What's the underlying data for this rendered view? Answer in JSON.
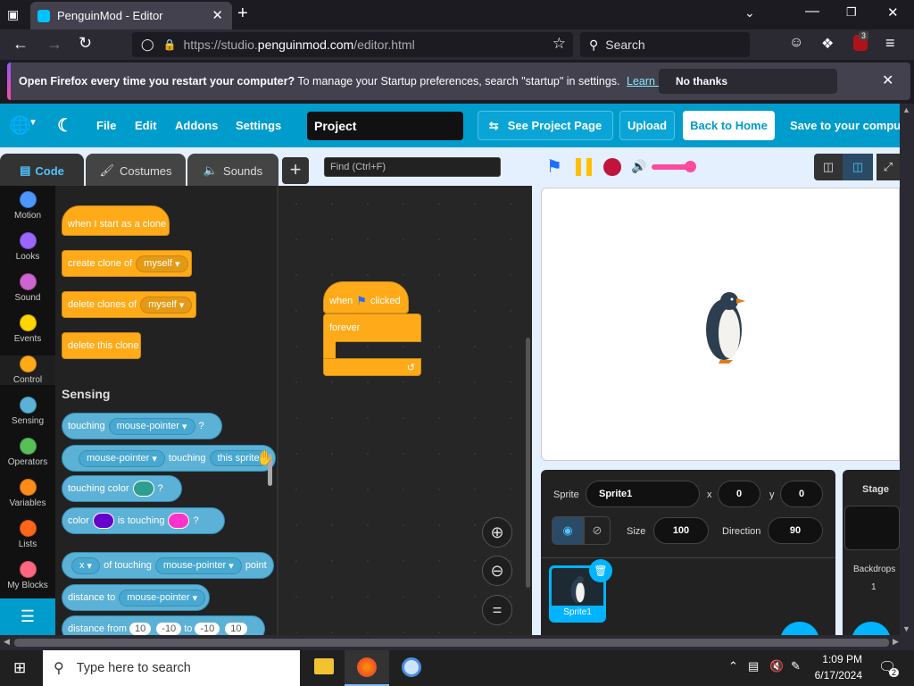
{
  "browser": {
    "tab_title": "PenguinMod - Editor",
    "url_prefix": "https://studio.",
    "url_domain": "penguinmod.com",
    "url_path": "/editor.html",
    "search_placeholder": "Search",
    "ext_badge": "3"
  },
  "notification": {
    "bold": "Open Firefox every time you restart your computer?",
    "text": " To manage your Startup preferences, search \"startup\" in settings.",
    "link": "Learn more",
    "no_thanks": "No thanks"
  },
  "menu": {
    "file": "File",
    "edit": "Edit",
    "addons": "Addons",
    "settings": "Settings",
    "project_title": "Project",
    "see_project": "See Project Page",
    "upload": "Upload",
    "back_home": "Back to Home",
    "save": "Save to your computer"
  },
  "tabs": {
    "code": "Code",
    "costumes": "Costumes",
    "sounds": "Sounds",
    "find_placeholder": "Find (Ctrl+F)"
  },
  "categories": [
    {
      "label": "Motion",
      "color": "#4c97ff"
    },
    {
      "label": "Looks",
      "color": "#9966ff"
    },
    {
      "label": "Sound",
      "color": "#cf63cf"
    },
    {
      "label": "Events",
      "color": "#ffd500"
    },
    {
      "label": "Control",
      "color": "#ffab19"
    },
    {
      "label": "Sensing",
      "color": "#5cb1d6"
    },
    {
      "label": "Operators",
      "color": "#59c059"
    },
    {
      "label": "Variables",
      "color": "#ff8c1a"
    },
    {
      "label": "Lists",
      "color": "#ff661a"
    },
    {
      "label": "My Blocks",
      "color": "#ff6680"
    }
  ],
  "palette": {
    "when_clone": "when I start as a clone",
    "create_clone": "create clone of",
    "myself": "myself",
    "delete_clones": "delete clones of",
    "delete_this": "delete this clone",
    "sensing_heading": "Sensing",
    "touching": "touching",
    "mouse_pointer": "mouse-pointer",
    "q": "?",
    "touching_word": "touching",
    "this_sprite": "this sprite",
    "touching_color": "touching color",
    "color": "color",
    "is_touching": "is touching",
    "x": "x",
    "of_touching": "of touching",
    "point": "point",
    "distance_to": "distance to",
    "distance_from": "distance from",
    "n10": "10",
    "nm10": "-10",
    "to": "to"
  },
  "script": {
    "when": "when",
    "clicked": "clicked",
    "forever": "forever"
  },
  "sprite": {
    "sprite_label": "Sprite",
    "name": "Sprite1",
    "x_label": "x",
    "x": "0",
    "y_label": "y",
    "y": "0",
    "size_label": "Size",
    "size": "100",
    "direction_label": "Direction",
    "direction": "90",
    "thumb_label": "Sprite1"
  },
  "stage_panel": {
    "title": "Stage",
    "backdrops_label": "Backdrops",
    "backdrops": "1"
  },
  "taskbar": {
    "search_placeholder": "Type here to search",
    "time": "1:09 PM",
    "date": "6/17/2024",
    "notif_count": "2"
  }
}
